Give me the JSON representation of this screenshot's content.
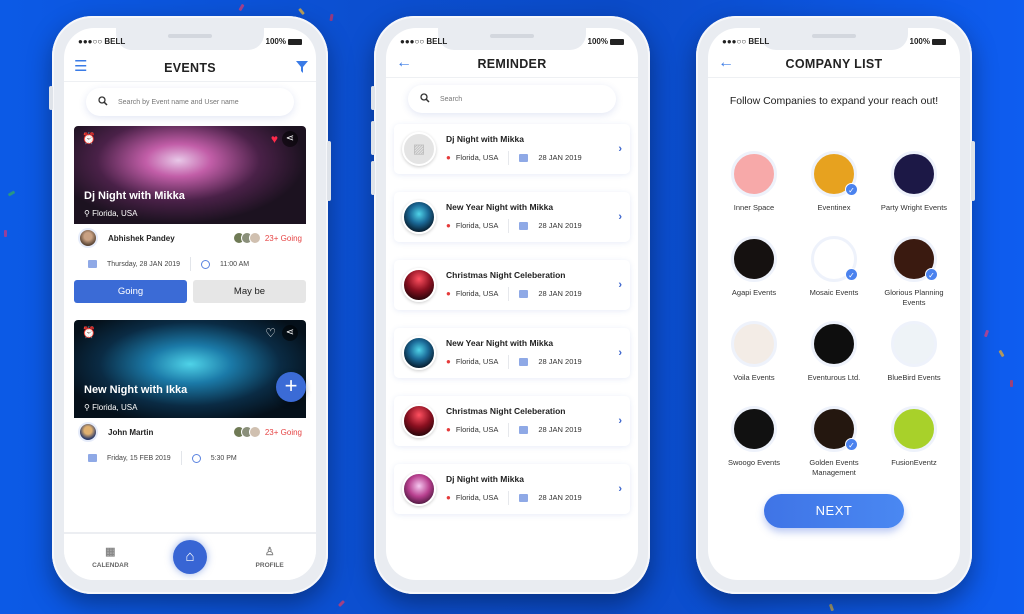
{
  "status_bar": {
    "carrier": "●●●○○ BELL",
    "battery": "100%"
  },
  "events_screen": {
    "title": "EVENTS",
    "search_placeholder": "Search by Event name and User name",
    "events": [
      {
        "name": "Dj Night with Mikka",
        "location": "Florida, USA",
        "host": "Abhishek Pandey",
        "going": "23+ Going",
        "date": "Thursday, 28 JAN 2019",
        "time": "11:00 AM",
        "favorited": true
      },
      {
        "name": "New Night with Ikka",
        "location": "Florida, USA",
        "host": "John Martin",
        "going": "23+ Going",
        "date": "Friday, 15 FEB 2019",
        "time": "5:30 PM",
        "favorited": false
      }
    ],
    "going_label": "Going",
    "maybe_label": "May be",
    "tabs": [
      {
        "label": "CALENDAR",
        "icon": "calendar-icon"
      },
      {
        "label": "",
        "icon": "home-icon"
      },
      {
        "label": "PROFILE",
        "icon": "profile-icon"
      }
    ]
  },
  "reminder_screen": {
    "title": "REMINDER",
    "search_placeholder": "Search",
    "items": [
      {
        "title": "Dj Night with Mikka",
        "location": "Florida, USA",
        "date": "28 JAN 2019",
        "thumb": "placeholder"
      },
      {
        "title": "New Year Night with Mikka",
        "location": "Florida, USA",
        "date": "28 JAN 2019",
        "thumb": "blue"
      },
      {
        "title": "Christmas Night Celeberation",
        "location": "Florida, USA",
        "date": "28 JAN 2019",
        "thumb": "red"
      },
      {
        "title": "New Year Night with Mikka",
        "location": "Florida, USA",
        "date": "28 JAN 2019",
        "thumb": "blue"
      },
      {
        "title": "Christmas Night Celeberation",
        "location": "Florida, USA",
        "date": "28 JAN 2019",
        "thumb": "red"
      },
      {
        "title": "Dj Night with Mikka",
        "location": "Florida, USA",
        "date": "28 JAN 2019",
        "thumb": "purple"
      }
    ]
  },
  "company_screen": {
    "title": "COMPANY LIST",
    "subtitle": "Follow Companies to expand your reach out!",
    "companies": [
      {
        "name": "Inner Space",
        "followed": false,
        "color": "#f7a9a9"
      },
      {
        "name": "Eventinex",
        "followed": true,
        "color": "#e7a21f"
      },
      {
        "name": "Party Wright Events",
        "followed": false,
        "color": "#1c1846"
      },
      {
        "name": "Agapi Events",
        "followed": false,
        "color": "#151110"
      },
      {
        "name": "Mosaic Events",
        "followed": true,
        "color": "#ffffff"
      },
      {
        "name": "Glorious Planning Events",
        "followed": true,
        "color": "#3a1a10"
      },
      {
        "name": "Voila Events",
        "followed": false,
        "color": "#f3ece6"
      },
      {
        "name": "Eventurous Ltd.",
        "followed": false,
        "color": "#0e0e0e"
      },
      {
        "name": "BlueBird Events",
        "followed": false,
        "color": "#eef3f7"
      },
      {
        "name": "Swoogo Events",
        "followed": false,
        "color": "#111111"
      },
      {
        "name": "Golden Events Management",
        "followed": true,
        "color": "#24170f"
      },
      {
        "name": "FusionEventz",
        "followed": false,
        "color": "#a8d12a"
      }
    ],
    "next_label": "NEXT"
  },
  "colors": {
    "background": "#0c51d6",
    "accent": "#3b6bd6",
    "danger": "#e64545"
  }
}
